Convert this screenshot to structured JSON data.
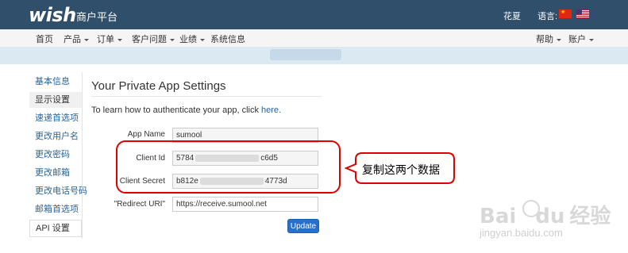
{
  "header": {
    "logo": "wish",
    "platform": "商户平台",
    "user": "花夏",
    "language_label": "语言:"
  },
  "nav": {
    "left": [
      {
        "label": "首页",
        "has_caret": false
      },
      {
        "label": "产品",
        "has_caret": true
      },
      {
        "label": "订单",
        "has_caret": true
      },
      {
        "label": "客户问题",
        "has_caret": true
      },
      {
        "label": "业绩",
        "has_caret": true
      },
      {
        "label": "系统信息",
        "has_caret": false
      }
    ],
    "right": [
      {
        "label": "帮助",
        "has_caret": true
      },
      {
        "label": "账户",
        "has_caret": true
      }
    ]
  },
  "sidebar": {
    "items": [
      {
        "label": "基本信息"
      },
      {
        "label": "显示设置"
      },
      {
        "label": "速递首选项"
      },
      {
        "label": "更改用户名"
      },
      {
        "label": "更改密码"
      },
      {
        "label": "更改邮箱"
      },
      {
        "label": "更改电话号码"
      },
      {
        "label": "邮箱首选项"
      },
      {
        "label": "API 设置"
      }
    ]
  },
  "main": {
    "title": "Your Private App Settings",
    "hint_text": "To learn how to authenticate your app, click ",
    "hint_link": "here.",
    "fields": {
      "app_name": {
        "label": "App Name",
        "value": "sumool"
      },
      "client_id": {
        "label": "Client Id",
        "prefix": "5784",
        "suffix": "c6d5"
      },
      "client_secret": {
        "label": "Client Secret",
        "prefix": "b812e",
        "suffix": "4773d"
      },
      "redirect_uri": {
        "label": "\"Redirect URI\"",
        "value": "https://receive.sumool.net"
      }
    },
    "update_button": "Update"
  },
  "annotation": {
    "callout": "复制这两个数据",
    "color": "#dd0000"
  },
  "watermark": {
    "brand": "Bai",
    "brand2": "du",
    "site": "经验",
    "url": "jingyan.baidu.com"
  },
  "colors": {
    "header_bg": "#2f4f6b",
    "link": "#2a6496",
    "button": "#2a70c8"
  }
}
